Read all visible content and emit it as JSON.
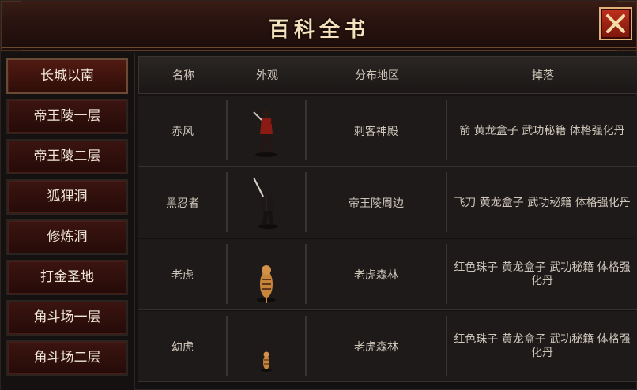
{
  "window": {
    "title": "百科全书"
  },
  "close_button": {
    "icon": "close-icon"
  },
  "sidebar": {
    "items": [
      {
        "label": "长城以南",
        "active": true
      },
      {
        "label": "帝王陵一层"
      },
      {
        "label": "帝王陵二层"
      },
      {
        "label": "狐狸洞"
      },
      {
        "label": "修炼洞"
      },
      {
        "label": "打金圣地"
      },
      {
        "label": "角斗场一层"
      },
      {
        "label": "角斗场二层"
      }
    ]
  },
  "table": {
    "columns": [
      "名称",
      "外观",
      "分布地区",
      "掉落"
    ],
    "rows": [
      {
        "name": "赤风",
        "appearance": "red-assassin-sprite",
        "region": "刺客神殿",
        "drops": "箭 黄龙盒子 武功秘籍 体格强化丹"
      },
      {
        "name": "黑忍者",
        "appearance": "black-ninja-sprite",
        "region": "帝王陵周边",
        "drops": "飞刀 黄龙盒子 武功秘籍 体格强化丹"
      },
      {
        "name": "老虎",
        "appearance": "tiger-sprite",
        "region": "老虎森林",
        "drops": "红色珠子 黄龙盒子 武功秘籍 体格强化丹"
      },
      {
        "name": "幼虎",
        "appearance": "cub-tiger-sprite",
        "region": "老虎森林",
        "drops": "红色珠子 黄龙盒子 武功秘籍 体格强化丹"
      }
    ]
  }
}
